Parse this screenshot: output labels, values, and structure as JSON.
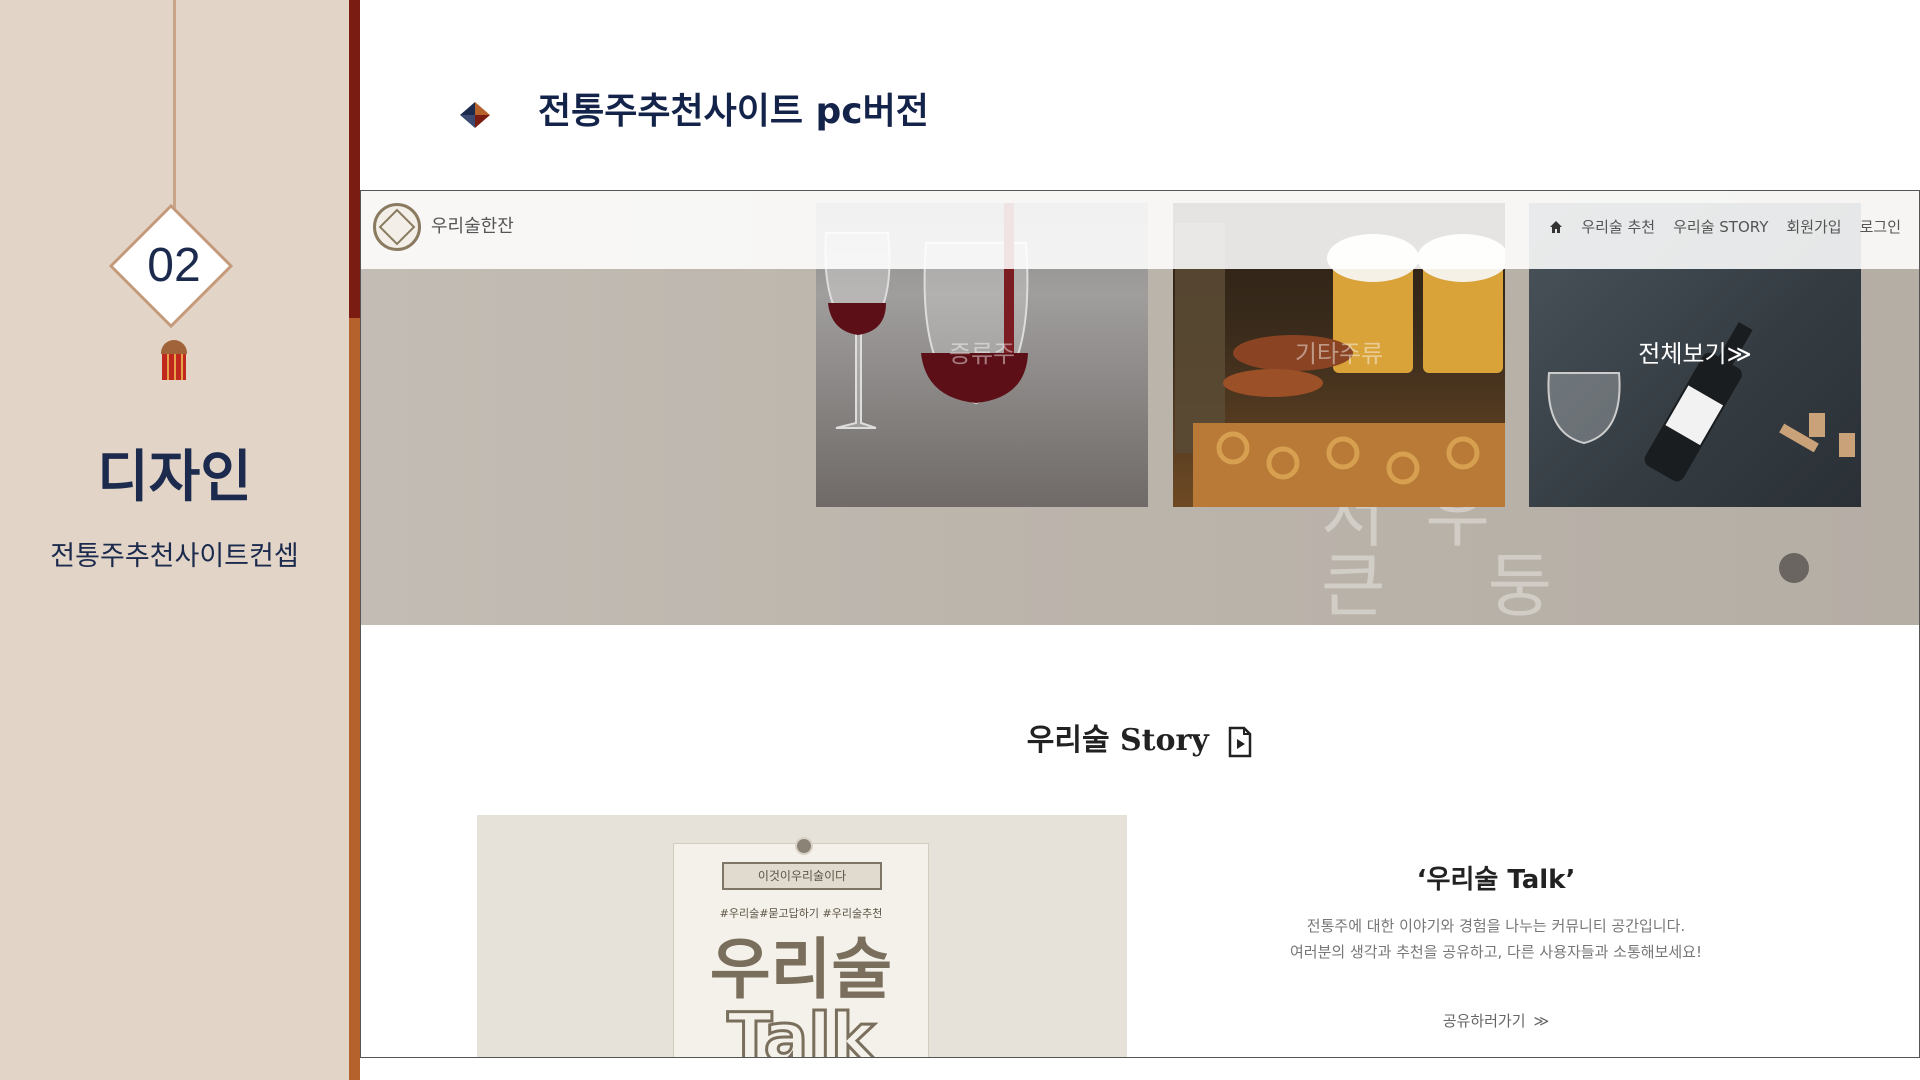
{
  "slide": {
    "number": "02",
    "section_title": "디자인",
    "section_subtitle": "전통주추천사이트컨셉",
    "heading": "전통주추천사이트 pc버전",
    "colors": {
      "navy": "#1b2a4d",
      "beige": "#e2d5c8",
      "dark_red": "#7a1c12",
      "copper": "#b5622c"
    }
  },
  "site": {
    "logo_text": "우리술한잔",
    "nav": {
      "home_icon": "home-icon",
      "items": [
        "우리술 추천",
        "우리술 STORY",
        "회원가입",
        "로그인"
      ]
    },
    "hero": {
      "cards": [
        {
          "label": "증류주"
        },
        {
          "label": "기타주류"
        },
        {
          "label": "전체보기≫"
        }
      ]
    },
    "story": {
      "title": "우리술 Story",
      "icon": "document-play-icon"
    },
    "talk": {
      "poster_ribbon": "이것이우리술이다",
      "poster_tags": "#우리술#묻고답하기 #우리술추천",
      "poster_big": "우리술",
      "poster_talk": "Talk",
      "title": "‘우리술 Talk’",
      "desc_line1": "전통주에 대한 이야기와 경험을 나누는 커뮤니티 공간입니다.",
      "desc_line2": "여러분의 생각과 추천을 공유하고, 다른 사용자들과 소통해보세요!",
      "share_label": "공유하러가기"
    }
  }
}
